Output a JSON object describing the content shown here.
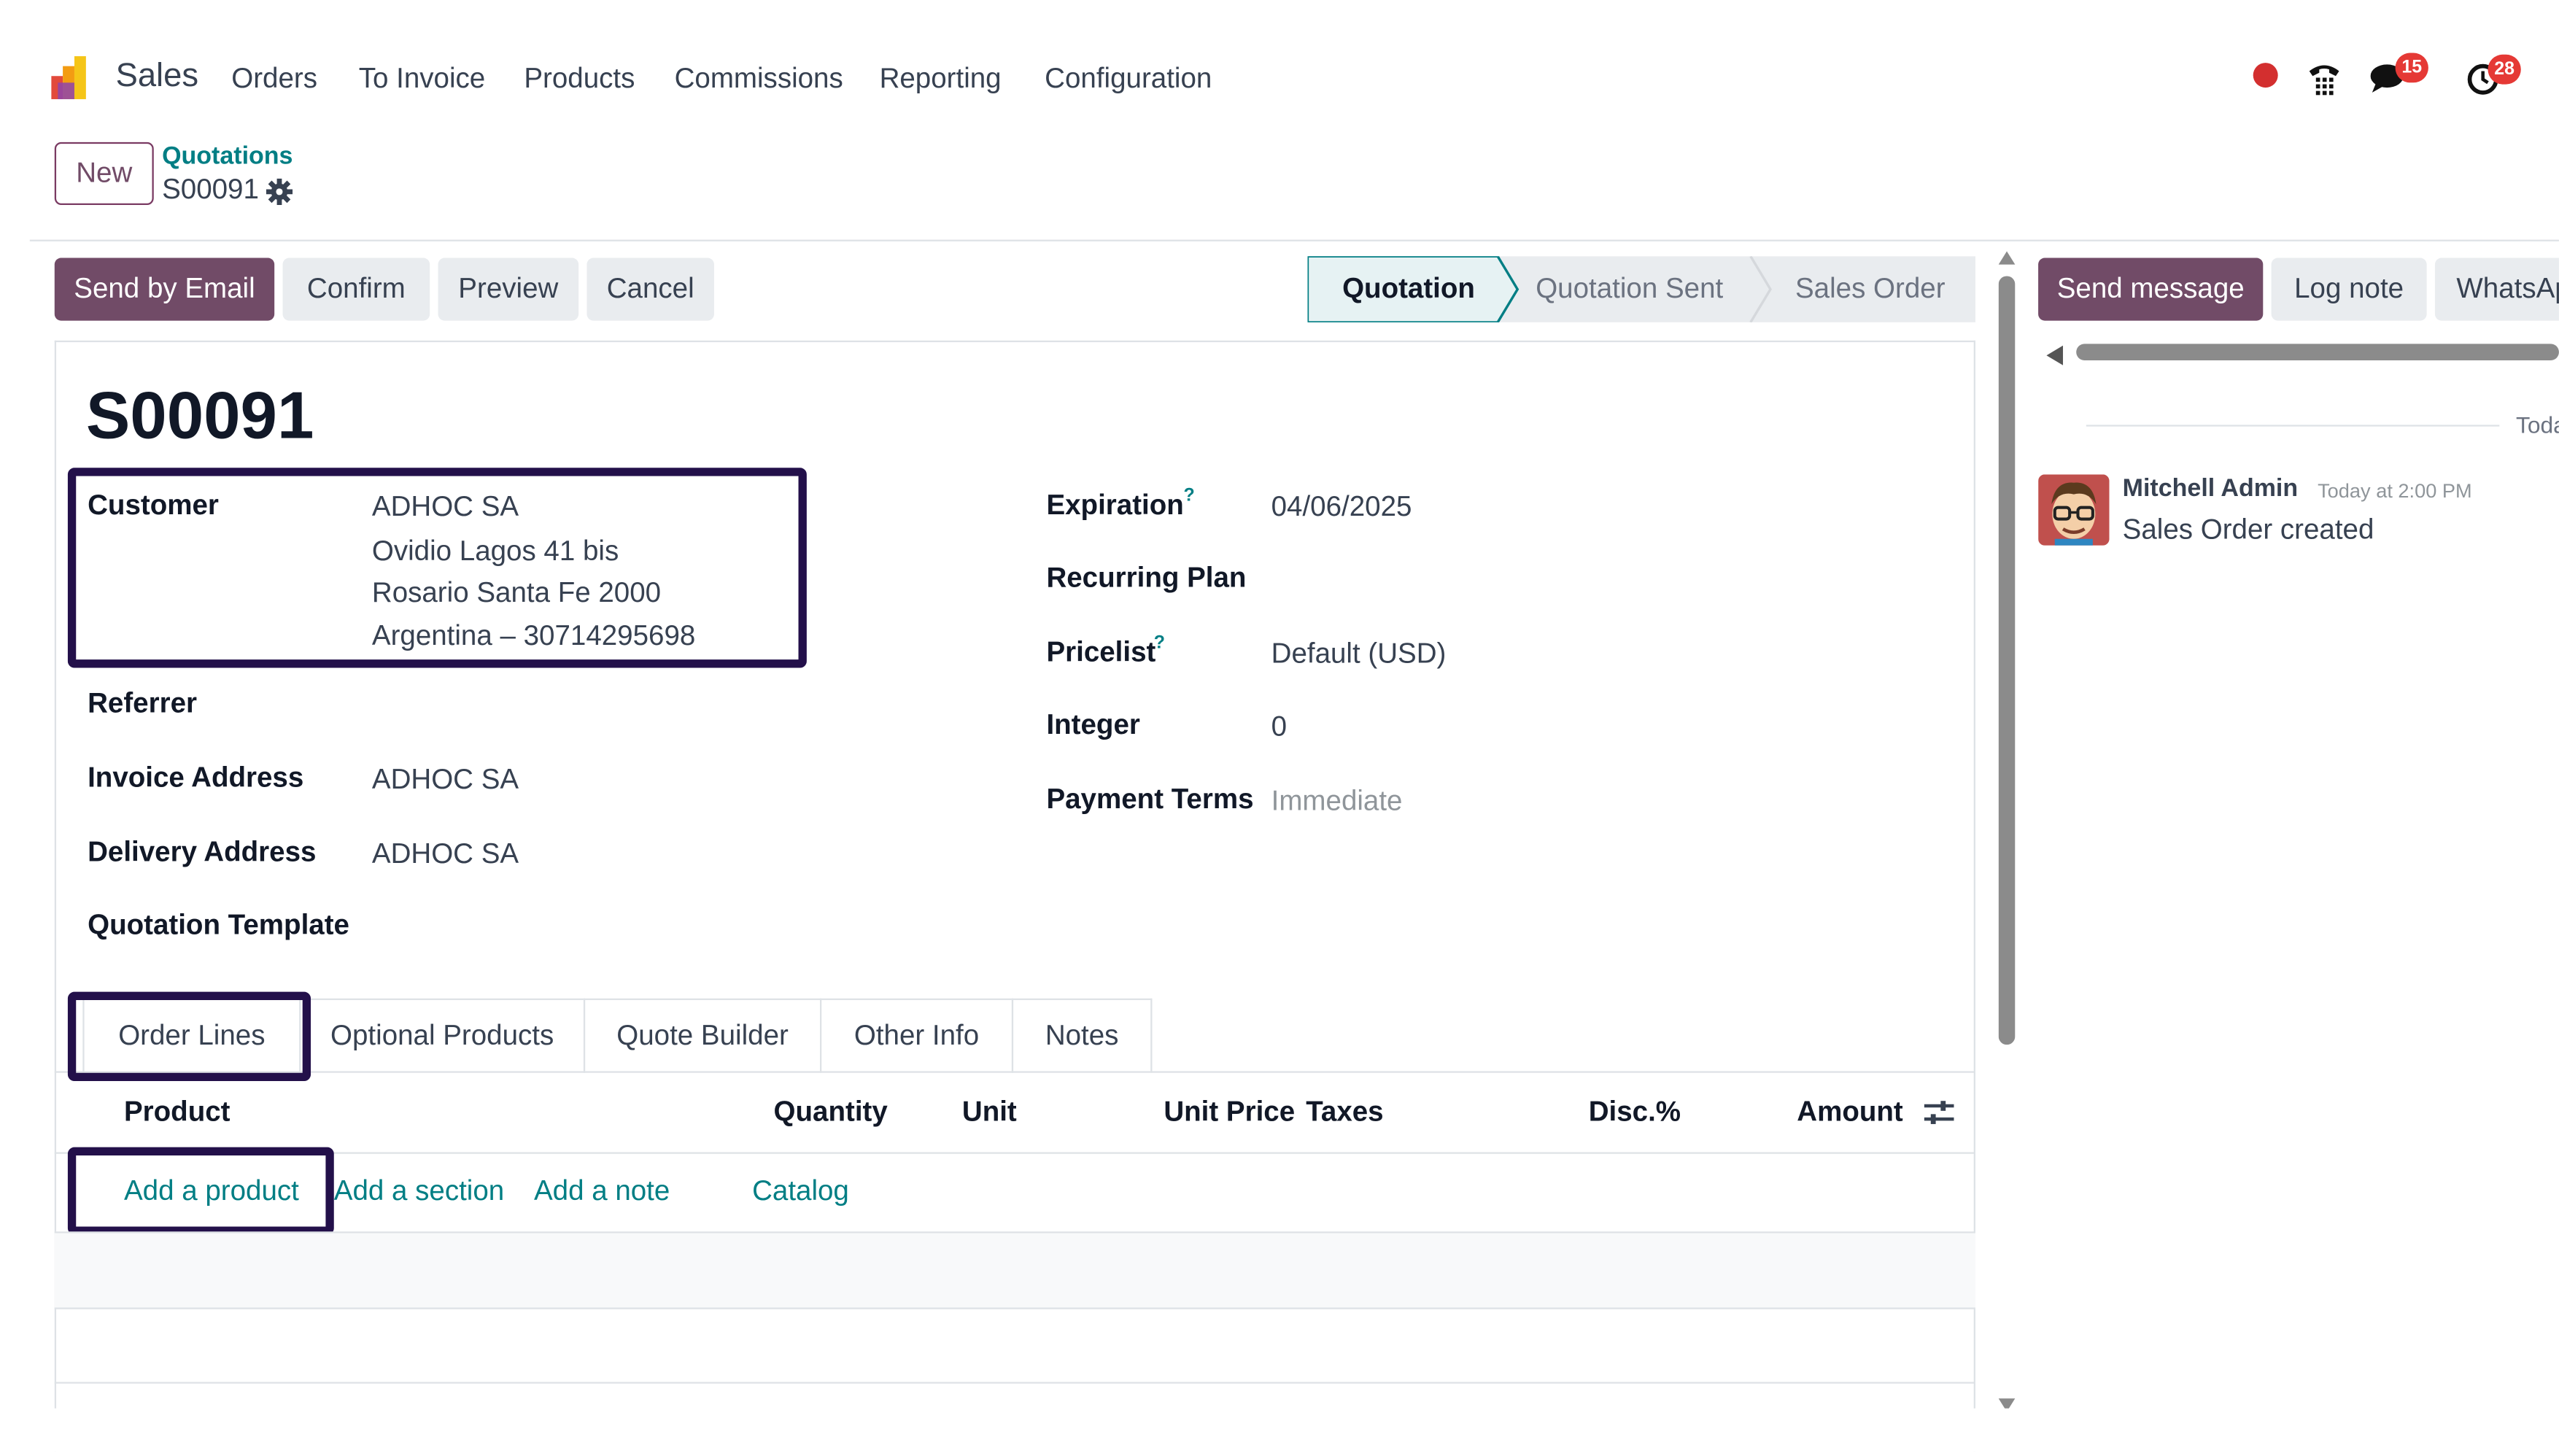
{
  "nav": {
    "app_name": "Sales",
    "menu": [
      "Orders",
      "To Invoice",
      "Products",
      "Commissions",
      "Reporting",
      "Configuration"
    ],
    "messages_badge": "15",
    "activities_badge": "28"
  },
  "breadcrumb": {
    "new_label": "New",
    "parent": "Quotations",
    "current": "S00091"
  },
  "actions": {
    "send_email": "Send by Email",
    "confirm": "Confirm",
    "preview": "Preview",
    "cancel": "Cancel"
  },
  "status": {
    "steps": [
      "Quotation",
      "Quotation Sent",
      "Sales Order"
    ],
    "active": "Quotation"
  },
  "form": {
    "title": "S00091",
    "customer_label": "Customer",
    "customer_name": "ADHOC SA",
    "customer_address_1": "Ovidio Lagos 41 bis",
    "customer_address_2": "Rosario Santa Fe 2000",
    "customer_address_3": "Argentina – 30714295698",
    "referrer_label": "Referrer",
    "invoice_label": "Invoice Address",
    "invoice_value": "ADHOC SA",
    "delivery_label": "Delivery Address",
    "delivery_value": "ADHOC SA",
    "template_label": "Quotation Template",
    "expiration_label": "Expiration",
    "expiration_value": "04/06/2025",
    "recurring_label": "Recurring Plan",
    "pricelist_label": "Pricelist",
    "pricelist_value": "Default (USD)",
    "integer_label": "Integer",
    "integer_value": "0",
    "payment_label": "Payment Terms",
    "payment_placeholder": "Immediate",
    "help_mark": "?"
  },
  "tabs": [
    "Order Lines",
    "Optional Products",
    "Quote Builder",
    "Other Info",
    "Notes"
  ],
  "order_lines": {
    "columns": [
      "Product",
      "Quantity",
      "Unit",
      "Unit Price",
      "Taxes",
      "Disc.%",
      "Amount"
    ],
    "add_product": "Add a product",
    "add_section": "Add a section",
    "add_note": "Add a note",
    "catalog": "Catalog"
  },
  "chatter": {
    "send_message": "Send message",
    "log_note": "Log note",
    "whatsapp": "WhatsApp",
    "date_separator": "Today",
    "author": "Mitchell Admin",
    "time": "Today at 2:00 PM",
    "body": "Sales Order created"
  },
  "colors": {
    "brand": "#714b67",
    "link": "#017e84",
    "highlight_box": "#23104a",
    "badge": "#e53935",
    "record_dot": "#d32f2f"
  }
}
